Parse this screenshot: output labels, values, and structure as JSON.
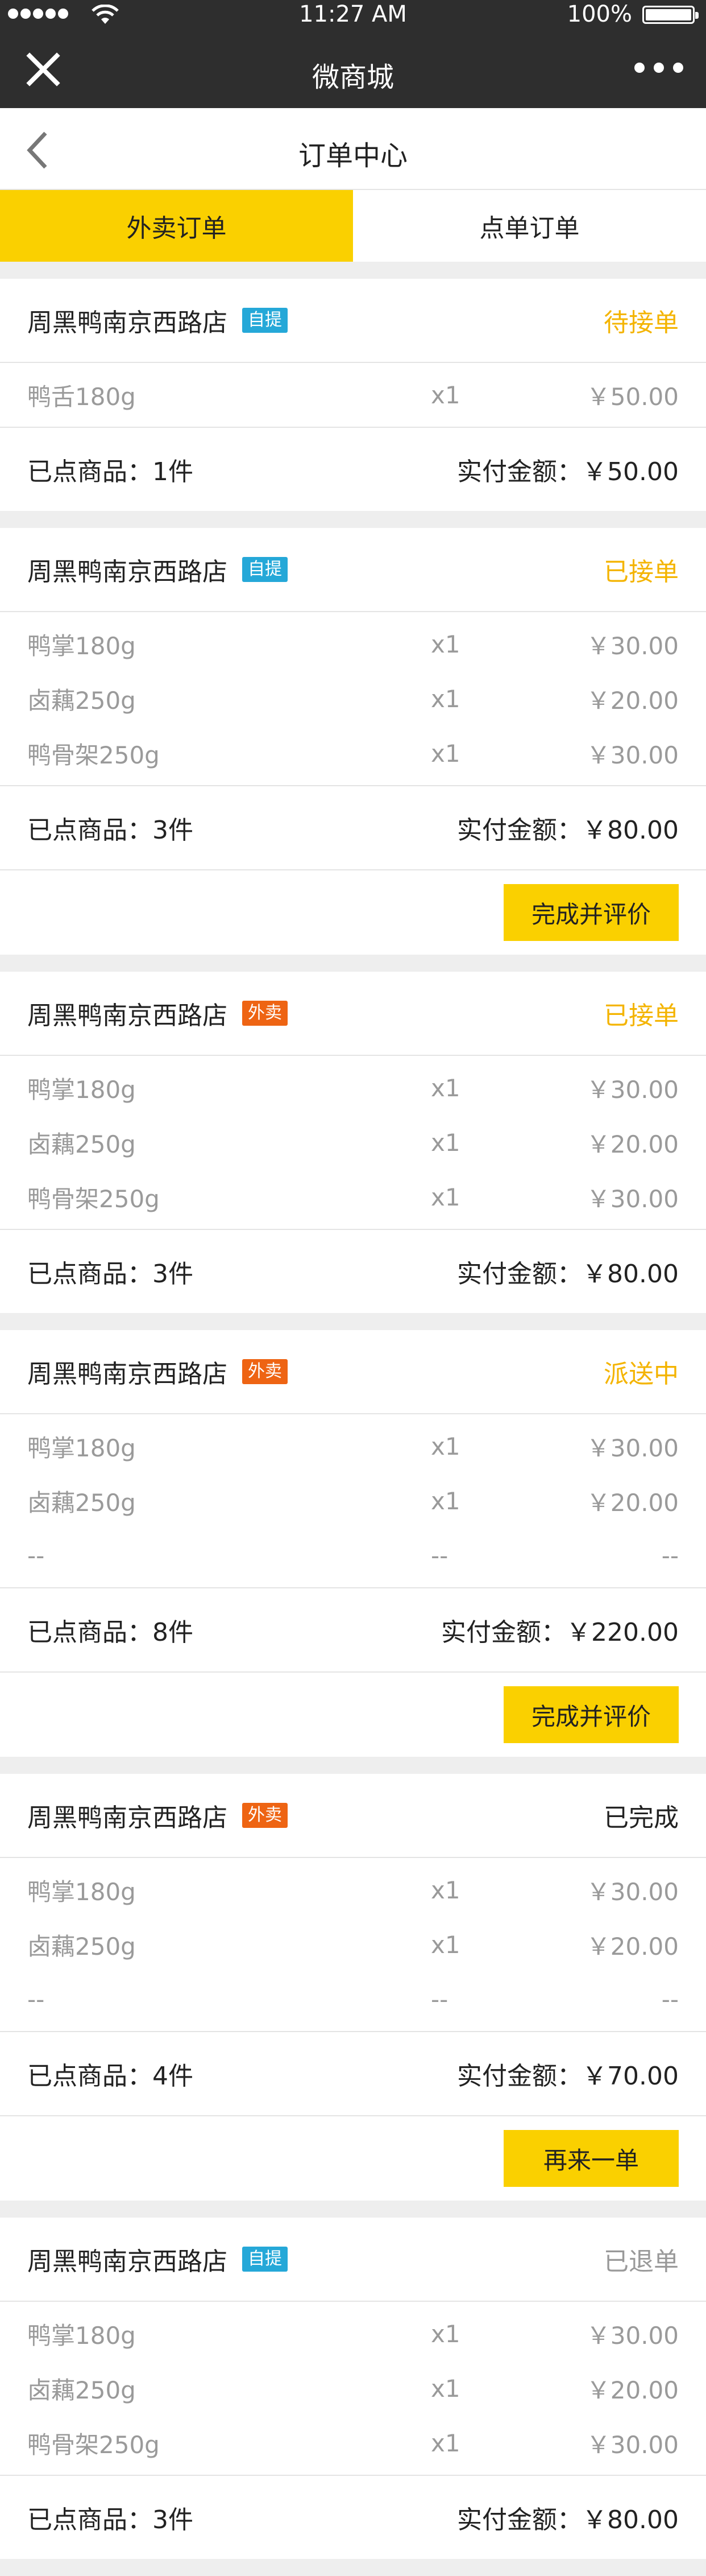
{
  "status_bar": {
    "time": "11:27 AM",
    "battery": "100%"
  },
  "nav": {
    "title": "微商城"
  },
  "header": {
    "title": "订单中心"
  },
  "tabs": [
    {
      "label": "外卖订单",
      "active": true
    },
    {
      "label": "点单订单",
      "active": false
    }
  ],
  "orders": [
    {
      "shop": "周黑鸭南京西路店",
      "tag": "自提",
      "tag_color": "#25a8d8",
      "status": "待接单",
      "status_color": "#f4b400",
      "items": [
        {
          "name": "鸭舌180g",
          "qty": "x1",
          "price": "￥50.00"
        }
      ],
      "count": "已点商品：1件",
      "total": "实付金额：￥50.00"
    },
    {
      "shop": "周黑鸭南京西路店",
      "tag": "自提",
      "tag_color": "#25a8d8",
      "status": "已接单",
      "status_color": "#f4b400",
      "items": [
        {
          "name": "鸭掌180g",
          "qty": "x1",
          "price": "￥30.00"
        },
        {
          "name": "卤藕250g",
          "qty": "x1",
          "price": "￥20.00"
        },
        {
          "name": "鸭骨架250g",
          "qty": "x1",
          "price": "￥30.00"
        }
      ],
      "count": "已点商品：3件",
      "total": "实付金额：￥80.00",
      "action": "完成并评价"
    },
    {
      "shop": "周黑鸭南京西路店",
      "tag": "外卖",
      "tag_color": "#ee6413",
      "status": "已接单",
      "status_color": "#f4b400",
      "items": [
        {
          "name": "鸭掌180g",
          "qty": "x1",
          "price": "￥30.00"
        },
        {
          "name": "卤藕250g",
          "qty": "x1",
          "price": "￥20.00"
        },
        {
          "name": "鸭骨架250g",
          "qty": "x1",
          "price": "￥30.00"
        }
      ],
      "count": "已点商品：3件",
      "total": "实付金额：￥80.00"
    },
    {
      "shop": "周黑鸭南京西路店",
      "tag": "外卖",
      "tag_color": "#ee6413",
      "status": "派送中",
      "status_color": "#f4b400",
      "items": [
        {
          "name": "鸭掌180g",
          "qty": "x1",
          "price": "￥30.00"
        },
        {
          "name": "卤藕250g",
          "qty": "x1",
          "price": "￥20.00"
        },
        {
          "name": "--",
          "qty": "--",
          "price": "--"
        }
      ],
      "count": "已点商品：8件",
      "total": "实付金额：￥220.00",
      "action": "完成并评价"
    },
    {
      "shop": "周黑鸭南京西路店",
      "tag": "外卖",
      "tag_color": "#ee6413",
      "status": "已完成",
      "status_color": "#222222",
      "items": [
        {
          "name": "鸭掌180g",
          "qty": "x1",
          "price": "￥30.00"
        },
        {
          "name": "卤藕250g",
          "qty": "x1",
          "price": "￥20.00"
        },
        {
          "name": "--",
          "qty": "--",
          "price": "--"
        }
      ],
      "count": "已点商品：4件",
      "total": "实付金额：￥70.00",
      "action": "再来一单"
    },
    {
      "shop": "周黑鸭南京西路店",
      "tag": "自提",
      "tag_color": "#25a8d8",
      "status": "已退单",
      "status_color": "#999999",
      "items": [
        {
          "name": "鸭掌180g",
          "qty": "x1",
          "price": "￥30.00"
        },
        {
          "name": "卤藕250g",
          "qty": "x1",
          "price": "￥20.00"
        },
        {
          "name": "鸭骨架250g",
          "qty": "x1",
          "price": "￥30.00"
        }
      ],
      "count": "已点商品：3件",
      "total": "实付金额：￥80.00"
    }
  ]
}
